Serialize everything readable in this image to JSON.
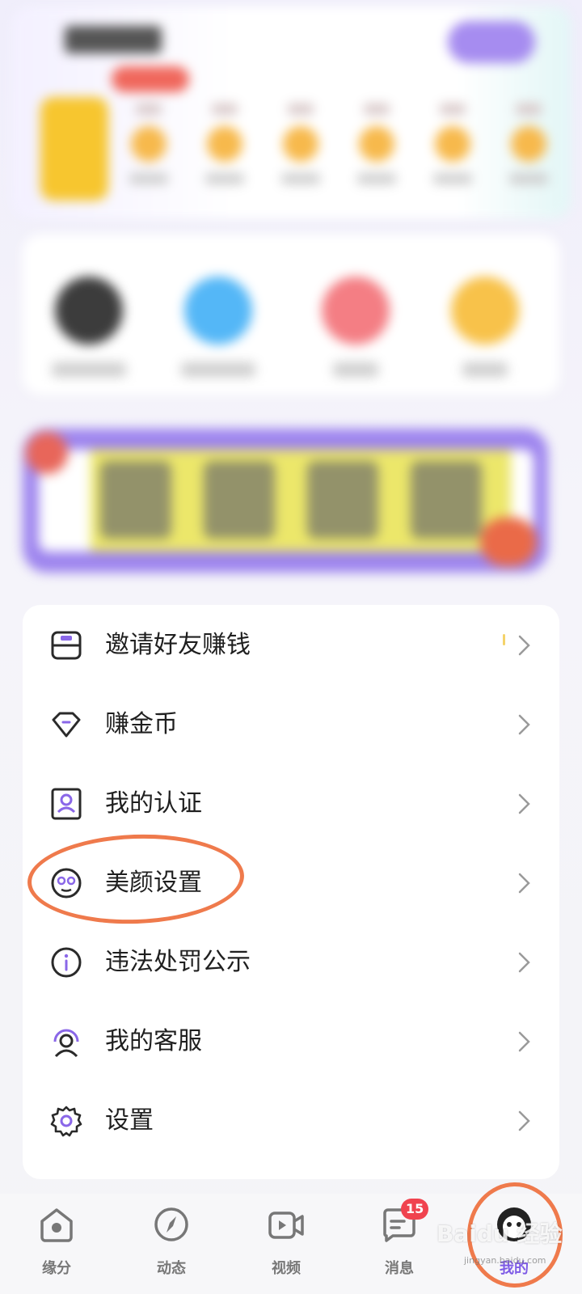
{
  "menu": {
    "items": [
      {
        "label": "邀请好友赚钱",
        "icon": "envelope-invite-icon"
      },
      {
        "label": "赚金币",
        "icon": "diamond-icon"
      },
      {
        "label": "我的认证",
        "icon": "id-card-icon"
      },
      {
        "label": "美颜设置",
        "icon": "face-mask-icon"
      },
      {
        "label": "违法处罚公示",
        "icon": "info-circle-icon"
      },
      {
        "label": "我的客服",
        "icon": "headset-icon"
      },
      {
        "label": "设置",
        "icon": "gear-icon"
      }
    ]
  },
  "nav": {
    "items": [
      {
        "label": "缘分",
        "icon": "home-icon"
      },
      {
        "label": "动态",
        "icon": "compass-icon"
      },
      {
        "label": "视频",
        "icon": "video-icon"
      },
      {
        "label": "消息",
        "icon": "message-icon"
      },
      {
        "label": "我的",
        "icon": "profile-face-icon"
      }
    ],
    "message_badge": "15",
    "active": "我的"
  },
  "watermark": {
    "text": "Baidu 经验",
    "sub": "jingyan.baidu.com"
  },
  "colors": {
    "accent": "#7e5be6",
    "annotation": "#ef7a4c",
    "badge": "#f0434f"
  }
}
